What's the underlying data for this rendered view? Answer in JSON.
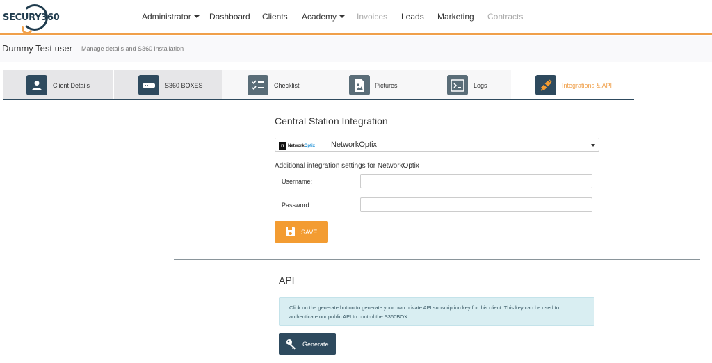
{
  "brand": {
    "logo_text": "SECURY",
    "logo_num": "360"
  },
  "nav": {
    "items": [
      {
        "label": "Administrator",
        "dropdown": true,
        "disabled": false
      },
      {
        "label": "Dashboard",
        "dropdown": false,
        "disabled": false
      },
      {
        "label": "Clients",
        "dropdown": false,
        "disabled": false
      },
      {
        "label": "Academy",
        "dropdown": true,
        "disabled": false
      },
      {
        "label": "Invoices",
        "dropdown": false,
        "disabled": true
      },
      {
        "label": "Leads",
        "dropdown": false,
        "disabled": false
      },
      {
        "label": "Marketing",
        "dropdown": false,
        "disabled": false
      },
      {
        "label": "Contracts",
        "dropdown": false,
        "disabled": true
      }
    ]
  },
  "page": {
    "title": "Dummy Test user",
    "subtitle": "Manage details and S360 installation"
  },
  "tabs": [
    {
      "label": "Client Details",
      "icon": "user-icon",
      "active": false
    },
    {
      "label": "S360 BOXES",
      "icon": "router-icon",
      "active": false
    },
    {
      "label": "Checklist",
      "icon": "checklist-icon",
      "active": false
    },
    {
      "label": "Pictures",
      "icon": "picture-icon",
      "active": false
    },
    {
      "label": "Logs",
      "icon": "terminal-icon",
      "active": false
    },
    {
      "label": "Integrations & API",
      "icon": "plug-icon",
      "active": true
    }
  ],
  "integration": {
    "title": "Central Station Integration",
    "selected_logo": {
      "letter": "n",
      "word_a": "Network",
      "word_b": "Optix"
    },
    "selected_value": "NetworkOptix",
    "additional_label": "Additional integration settings for NetworkOptix",
    "username_label": "Username:",
    "username_value": "",
    "password_label": "Password:",
    "password_value": "",
    "save_label": "SAVE"
  },
  "api": {
    "title": "API",
    "info_text": "Click on the generate button to generate your own private API subscription key for this client. This key can be used to authenticate our public API to control the S360BOX.",
    "generate_label": "Generate"
  },
  "colors": {
    "accent": "#f39c32",
    "dark": "#2e4a5e",
    "info_bg": "#d9eef2"
  }
}
